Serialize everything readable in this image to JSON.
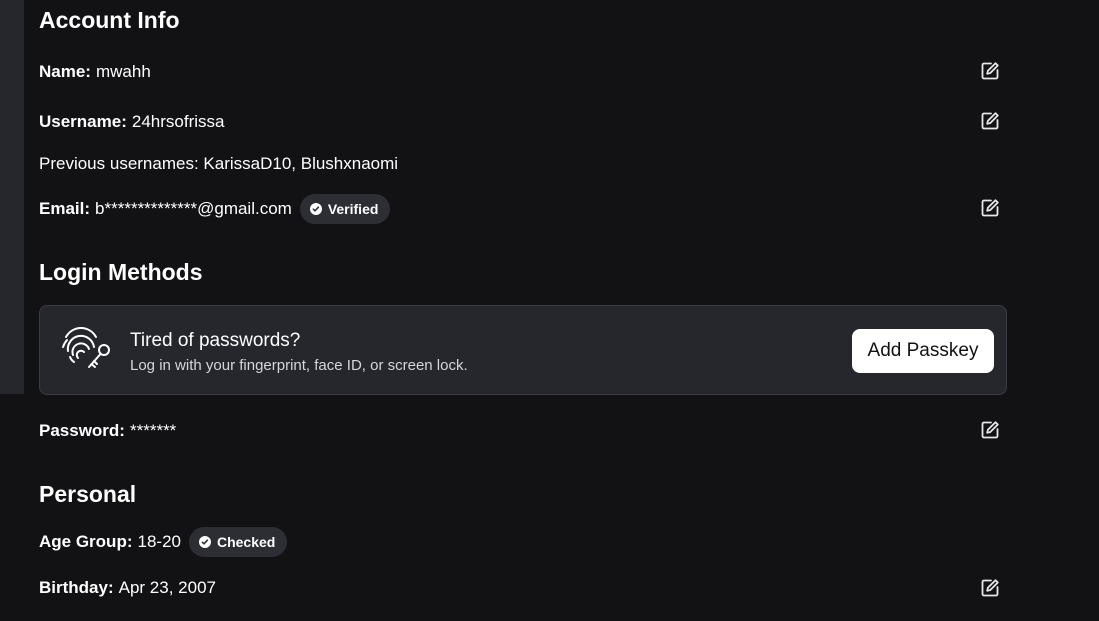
{
  "account_info": {
    "heading": "Account Info",
    "name": {
      "label": "Name:",
      "value": "mwahh"
    },
    "username": {
      "label": "Username:",
      "value": "24hrsofrissa"
    },
    "previous_usernames": "Previous usernames: KarissaD10, Blushxnaomi",
    "email": {
      "label": "Email:",
      "value": "b**************@gmail.com",
      "badge": "Verified"
    }
  },
  "login_methods": {
    "heading": "Login Methods",
    "passkey_card": {
      "title": "Tired of passwords?",
      "subtitle": "Log in with your fingerprint, face ID, or screen lock.",
      "button": "Add Passkey",
      "icon": "fingerprint-key-icon"
    },
    "password": {
      "label": "Password:",
      "value": "*******"
    }
  },
  "personal": {
    "heading": "Personal",
    "age_group": {
      "label": "Age Group:",
      "value": "18-20",
      "badge": "Checked"
    },
    "birthday": {
      "label": "Birthday:",
      "value": "Apr 23, 2007"
    }
  },
  "icons": {
    "edit": "edit-icon",
    "badge_check": "check-circle-icon"
  },
  "colors": {
    "background": "#121215",
    "card": "#25272c",
    "badge": "#2c2e33",
    "text": "#ffffff",
    "button_bg": "#ffffff"
  }
}
